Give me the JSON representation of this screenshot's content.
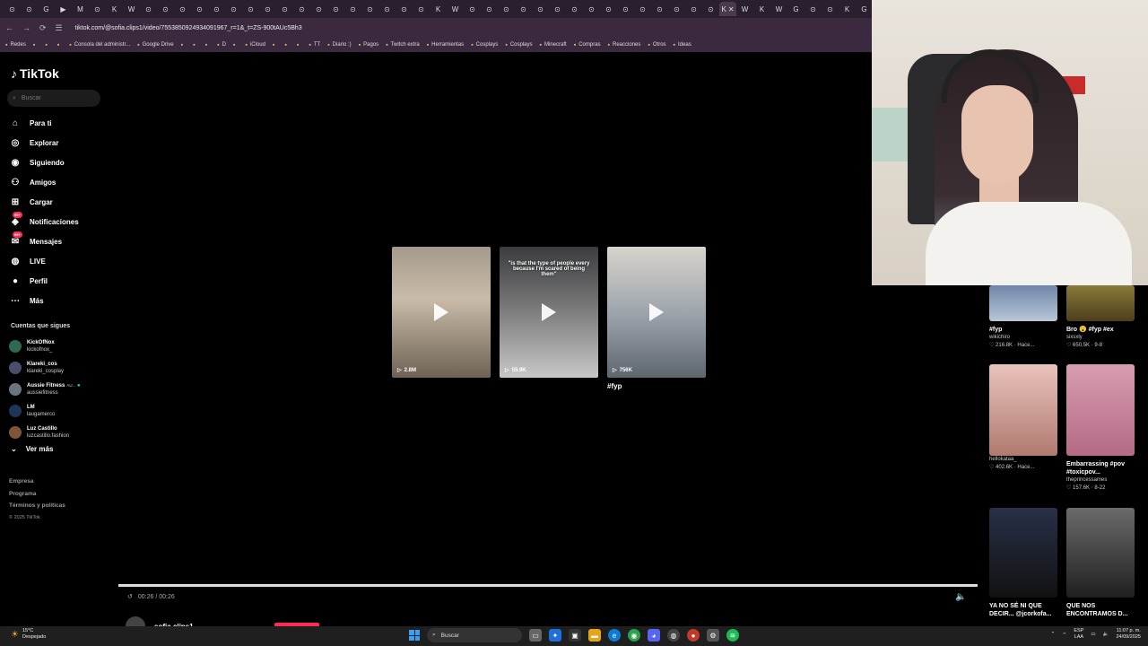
{
  "browser": {
    "tabs": [
      "⊙",
      "⊙",
      "G",
      "▶",
      "M",
      "⊙",
      "K",
      "W",
      "⊙",
      "⊙",
      "⊙",
      "⊙",
      "⊙",
      "⊙",
      "⊙",
      "⊙",
      "⊙",
      "⊙",
      "⊙",
      "⊙",
      "⊙",
      "⊙",
      "⊙",
      "⊙",
      "⊙",
      "K",
      "W",
      "⊙",
      "⊙",
      "⊙",
      "⊙",
      "⊙",
      "⊙",
      "⊙",
      "⊙",
      "⊙",
      "⊙",
      "⊙",
      "⊙",
      "⊙",
      "⊙",
      "⊙",
      "K",
      "W",
      "K",
      "W",
      "G",
      "⊙",
      "⊙",
      "K",
      "G"
    ],
    "active_tab_index": 42,
    "close_tab_symbol": "✕",
    "url": "tiktok.com/@sofia.clips1/video/7553850924934091967_r=1&_t=ZS-900tAUc5Bh3",
    "bookmarks": [
      "Redes",
      "",
      "",
      "",
      "Consola del administr...",
      "Google Drive",
      "",
      "",
      "",
      "D",
      "",
      "iCloud",
      "",
      "",
      "",
      "TT",
      "Diario :)",
      "Pagos",
      "Twitch extra",
      "Herramientas",
      "Cosplays",
      "Cosplays",
      "Minecraft",
      "Compras",
      "Reacciones",
      "Otros",
      "Ideas"
    ]
  },
  "sidebar": {
    "logo": "TikTok",
    "search_placeholder": "Buscar",
    "nav": [
      {
        "label": "Para ti",
        "icon": "home-icon"
      },
      {
        "label": "Explorar",
        "icon": "compass-icon"
      },
      {
        "label": "Siguiendo",
        "icon": "following-icon"
      },
      {
        "label": "Amigos",
        "icon": "friends-icon"
      },
      {
        "label": "Cargar",
        "icon": "upload-icon"
      },
      {
        "label": "Notificaciones",
        "icon": "notifications-icon"
      },
      {
        "label": "Mensajes",
        "icon": "messages-icon"
      },
      {
        "label": "LIVE",
        "icon": "live-icon"
      },
      {
        "label": "Perfil",
        "icon": "profile-icon"
      },
      {
        "label": "Más",
        "icon": "more-icon"
      }
    ],
    "following_title": "Cuentas que sigues",
    "following": [
      {
        "name": "KickOfNox",
        "handle": "kickofnox_"
      },
      {
        "name": "Klareki_cos",
        "handle": "klareki_cosplay"
      },
      {
        "name": "Aussie Fitness",
        "handle": "aussiefitness",
        "tag": "AU..."
      },
      {
        "name": "LM",
        "handle": "laugamerco"
      },
      {
        "name": "Luz Castillo",
        "handle": "luzcastillo.fashion"
      }
    ],
    "see_more": "Ver más",
    "footer": [
      "Empresa",
      "Programa",
      "Términos y políticas"
    ],
    "copyright": "© 2025 TikTok"
  },
  "center": {
    "thumbs": [
      {
        "views": "2.8M",
        "caption": ""
      },
      {
        "views": "55.9K",
        "caption": "\"is that the type of people every because I'm scared of being them\""
      },
      {
        "views": "756K",
        "caption": ""
      }
    ],
    "thumb_label": "#fyp"
  },
  "player": {
    "progress": 1.0,
    "time": "00:26 / 00:26",
    "author": "sofia.clips1"
  },
  "right_grid": [
    {
      "title": "#fyp",
      "sub": "wikichiro",
      "stat": "216.8K · Hace..."
    },
    {
      "title": "Bro 😮 #fyp #ex",
      "sub": "sixsxly",
      "stat": "650.5K · 9-8"
    },
    {
      "title": "",
      "sub": "hellokataa_",
      "stat": "402.6K · Hace..."
    },
    {
      "title": "Embarrassing #pov #toxicpov...",
      "sub": "theprincessames",
      "stat": "157.6K · 8-22"
    },
    {
      "title": "YA NO SÉ NI QUE DECIR... @jcorkofa...",
      "sub": "",
      "stat": ""
    },
    {
      "title": "QUE NOS ENCONTRAMOS D...",
      "sub": "",
      "stat": ""
    }
  ],
  "taskbar": {
    "temp": "15°C",
    "weather": "Despejado",
    "search": "Buscar",
    "lang1": "ESP",
    "lang2": "LAA",
    "time": "11:07 p. m.",
    "date": "24/09/2025"
  },
  "colors": {
    "accent": "#fe2c55",
    "chrome": "#3b2a3f",
    "bg": "#000000"
  }
}
